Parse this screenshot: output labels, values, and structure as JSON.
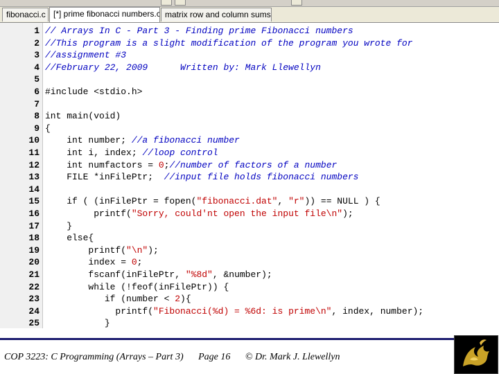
{
  "tabs": [
    {
      "label": "fibonacci.c",
      "active": false
    },
    {
      "label": "[*] prime fibonacci numbers.c",
      "active": true
    },
    {
      "label": "matrix row and column sums.c",
      "active": false
    }
  ],
  "code": {
    "lines": [
      {
        "num": "1",
        "tokens": [
          {
            "t": "// Arrays In C - Part 3 - Finding prime Fibonacci numbers",
            "c": "comment"
          }
        ]
      },
      {
        "num": "2",
        "tokens": [
          {
            "t": "//This program is a slight modification of the program you wrote for",
            "c": "comment"
          }
        ]
      },
      {
        "num": "3",
        "tokens": [
          {
            "t": "//assignment #3",
            "c": "comment"
          }
        ]
      },
      {
        "num": "4",
        "tokens": [
          {
            "t": "//February 22, 2009      Written by: Mark Llewellyn",
            "c": "comment"
          }
        ]
      },
      {
        "num": "5",
        "tokens": []
      },
      {
        "num": "6",
        "tokens": [
          {
            "t": "#include <stdio.h>",
            "c": "plain"
          }
        ]
      },
      {
        "num": "7",
        "tokens": []
      },
      {
        "num": "8",
        "tokens": [
          {
            "t": "int main(void)",
            "c": "plain"
          }
        ]
      },
      {
        "num": "9",
        "tokens": [
          {
            "t": "{",
            "c": "plain"
          }
        ]
      },
      {
        "num": "10",
        "tokens": [
          {
            "t": "    int number; ",
            "c": "plain"
          },
          {
            "t": "//a fibonacci number",
            "c": "comment"
          }
        ]
      },
      {
        "num": "11",
        "tokens": [
          {
            "t": "    int i, index; ",
            "c": "plain"
          },
          {
            "t": "//loop control",
            "c": "comment"
          }
        ]
      },
      {
        "num": "12",
        "tokens": [
          {
            "t": "    int numfactors = ",
            "c": "plain"
          },
          {
            "t": "0",
            "c": "number"
          },
          {
            "t": ";",
            "c": "plain"
          },
          {
            "t": "//number of factors of a number",
            "c": "comment"
          }
        ]
      },
      {
        "num": "13",
        "tokens": [
          {
            "t": "    FILE *inFilePtr;  ",
            "c": "plain"
          },
          {
            "t": "//input file holds fibonacci numbers",
            "c": "comment"
          }
        ]
      },
      {
        "num": "14",
        "tokens": []
      },
      {
        "num": "15",
        "tokens": [
          {
            "t": "    if ( (inFilePtr = fopen(",
            "c": "plain"
          },
          {
            "t": "\"fibonacci.dat\"",
            "c": "string"
          },
          {
            "t": ", ",
            "c": "plain"
          },
          {
            "t": "\"r\"",
            "c": "string"
          },
          {
            "t": ")) == NULL ) {",
            "c": "plain"
          }
        ]
      },
      {
        "num": "16",
        "tokens": [
          {
            "t": "         printf(",
            "c": "plain"
          },
          {
            "t": "\"Sorry, could'nt open the input file\\n\"",
            "c": "string"
          },
          {
            "t": ");",
            "c": "plain"
          }
        ]
      },
      {
        "num": "17",
        "tokens": [
          {
            "t": "    }",
            "c": "plain"
          }
        ]
      },
      {
        "num": "18",
        "tokens": [
          {
            "t": "    else{",
            "c": "plain"
          }
        ]
      },
      {
        "num": "19",
        "tokens": [
          {
            "t": "        printf(",
            "c": "plain"
          },
          {
            "t": "\"\\n\"",
            "c": "string"
          },
          {
            "t": ");",
            "c": "plain"
          }
        ]
      },
      {
        "num": "20",
        "tokens": [
          {
            "t": "        index = ",
            "c": "plain"
          },
          {
            "t": "0",
            "c": "number"
          },
          {
            "t": ";",
            "c": "plain"
          }
        ]
      },
      {
        "num": "21",
        "tokens": [
          {
            "t": "        fscanf(inFilePtr, ",
            "c": "plain"
          },
          {
            "t": "\"%8d\"",
            "c": "string"
          },
          {
            "t": ", &number);",
            "c": "plain"
          }
        ]
      },
      {
        "num": "22",
        "tokens": [
          {
            "t": "        while (!feof(inFilePtr)) {",
            "c": "plain"
          }
        ]
      },
      {
        "num": "23",
        "tokens": [
          {
            "t": "           if (number < ",
            "c": "plain"
          },
          {
            "t": "2",
            "c": "number"
          },
          {
            "t": "){",
            "c": "plain"
          }
        ]
      },
      {
        "num": "24",
        "tokens": [
          {
            "t": "             printf(",
            "c": "plain"
          },
          {
            "t": "\"Fibonacci(%d) = %6d: is prime\\n\"",
            "c": "string"
          },
          {
            "t": ", index, number);",
            "c": "plain"
          }
        ]
      },
      {
        "num": "25",
        "tokens": [
          {
            "t": "           }",
            "c": "plain"
          }
        ]
      }
    ]
  },
  "footer": {
    "course": "COP 3223: C Programming (Arrays – Part 3)",
    "page": "Page 16",
    "author": "© Dr. Mark J. Llewellyn"
  },
  "colors": {
    "comment": "#0000c0",
    "string": "#c00000",
    "keyword": "#000000",
    "footer_rule": "#1a1a6e"
  }
}
